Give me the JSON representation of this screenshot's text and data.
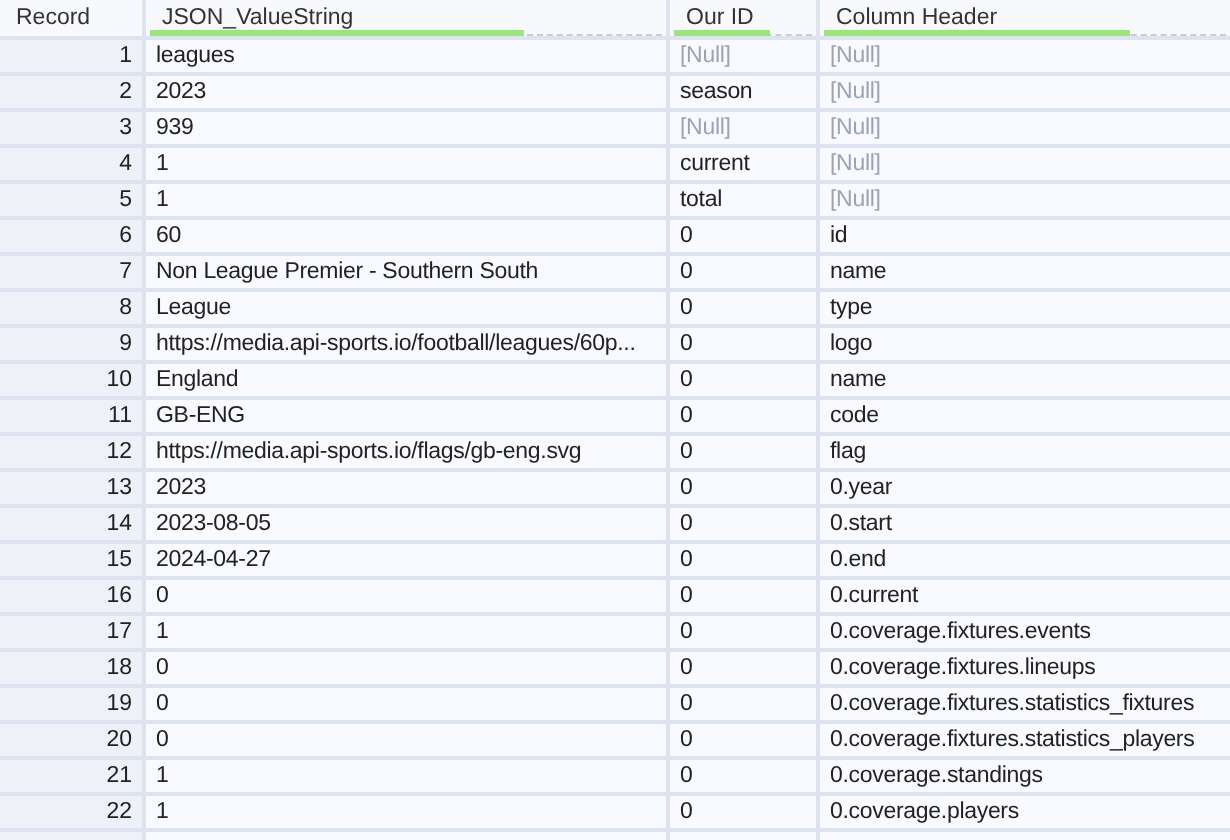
{
  "table": {
    "columns": [
      {
        "label": "Record",
        "kind": "index"
      },
      {
        "label": "JSON_ValueString",
        "kind": "data",
        "level": 0.73
      },
      {
        "label": "Our ID",
        "kind": "data",
        "level": 0.7
      },
      {
        "label": "Column Header",
        "kind": "data",
        "level": 0.76
      }
    ],
    "rows": [
      {
        "record": "1",
        "cells": [
          {
            "text": "leagues",
            "null": false
          },
          {
            "text": "[Null]",
            "null": true
          },
          {
            "text": "[Null]",
            "null": true
          }
        ]
      },
      {
        "record": "2",
        "cells": [
          {
            "text": "2023",
            "null": false
          },
          {
            "text": "season",
            "null": false
          },
          {
            "text": "[Null]",
            "null": true
          }
        ]
      },
      {
        "record": "3",
        "cells": [
          {
            "text": "939",
            "null": false
          },
          {
            "text": "[Null]",
            "null": true
          },
          {
            "text": "[Null]",
            "null": true
          }
        ]
      },
      {
        "record": "4",
        "cells": [
          {
            "text": "1",
            "null": false
          },
          {
            "text": "current",
            "null": false
          },
          {
            "text": "[Null]",
            "null": true
          }
        ]
      },
      {
        "record": "5",
        "cells": [
          {
            "text": "1",
            "null": false
          },
          {
            "text": "total",
            "null": false
          },
          {
            "text": "[Null]",
            "null": true
          }
        ]
      },
      {
        "record": "6",
        "cells": [
          {
            "text": "60",
            "null": false
          },
          {
            "text": "0",
            "null": false
          },
          {
            "text": "id",
            "null": false
          }
        ]
      },
      {
        "record": "7",
        "cells": [
          {
            "text": "Non League Premier - Southern South",
            "null": false
          },
          {
            "text": "0",
            "null": false
          },
          {
            "text": "name",
            "null": false
          }
        ]
      },
      {
        "record": "8",
        "cells": [
          {
            "text": "League",
            "null": false
          },
          {
            "text": "0",
            "null": false
          },
          {
            "text": "type",
            "null": false
          }
        ]
      },
      {
        "record": "9",
        "cells": [
          {
            "text": "https://media.api-sports.io/football/leagues/60p...",
            "null": false
          },
          {
            "text": "0",
            "null": false
          },
          {
            "text": "logo",
            "null": false
          }
        ]
      },
      {
        "record": "10",
        "cells": [
          {
            "text": "England",
            "null": false
          },
          {
            "text": "0",
            "null": false
          },
          {
            "text": "name",
            "null": false
          }
        ]
      },
      {
        "record": "11",
        "cells": [
          {
            "text": "GB-ENG",
            "null": false
          },
          {
            "text": "0",
            "null": false
          },
          {
            "text": "code",
            "null": false
          }
        ]
      },
      {
        "record": "12",
        "cells": [
          {
            "text": "https://media.api-sports.io/flags/gb-eng.svg",
            "null": false
          },
          {
            "text": "0",
            "null": false
          },
          {
            "text": "flag",
            "null": false
          }
        ]
      },
      {
        "record": "13",
        "cells": [
          {
            "text": "2023",
            "null": false
          },
          {
            "text": "0",
            "null": false
          },
          {
            "text": "0.year",
            "null": false
          }
        ]
      },
      {
        "record": "14",
        "cells": [
          {
            "text": "2023-08-05",
            "null": false
          },
          {
            "text": "0",
            "null": false
          },
          {
            "text": "0.start",
            "null": false
          }
        ]
      },
      {
        "record": "15",
        "cells": [
          {
            "text": "2024-04-27",
            "null": false
          },
          {
            "text": "0",
            "null": false
          },
          {
            "text": "0.end",
            "null": false
          }
        ]
      },
      {
        "record": "16",
        "cells": [
          {
            "text": "0",
            "null": false
          },
          {
            "text": "0",
            "null": false
          },
          {
            "text": "0.current",
            "null": false
          }
        ]
      },
      {
        "record": "17",
        "cells": [
          {
            "text": "1",
            "null": false
          },
          {
            "text": "0",
            "null": false
          },
          {
            "text": "0.coverage.fixtures.events",
            "null": false
          }
        ]
      },
      {
        "record": "18",
        "cells": [
          {
            "text": "0",
            "null": false
          },
          {
            "text": "0",
            "null": false
          },
          {
            "text": "0.coverage.fixtures.lineups",
            "null": false
          }
        ]
      },
      {
        "record": "19",
        "cells": [
          {
            "text": "0",
            "null": false
          },
          {
            "text": "0",
            "null": false
          },
          {
            "text": "0.coverage.fixtures.statistics_fixtures",
            "null": false
          }
        ]
      },
      {
        "record": "20",
        "cells": [
          {
            "text": "0",
            "null": false
          },
          {
            "text": "0",
            "null": false
          },
          {
            "text": "0.coverage.fixtures.statistics_players",
            "null": false
          }
        ]
      },
      {
        "record": "21",
        "cells": [
          {
            "text": "1",
            "null": false
          },
          {
            "text": "0",
            "null": false
          },
          {
            "text": "0.coverage.standings",
            "null": false
          }
        ]
      },
      {
        "record": "22",
        "cells": [
          {
            "text": "1",
            "null": false
          },
          {
            "text": "0",
            "null": false
          },
          {
            "text": "0.coverage.players",
            "null": false
          }
        ]
      }
    ]
  }
}
